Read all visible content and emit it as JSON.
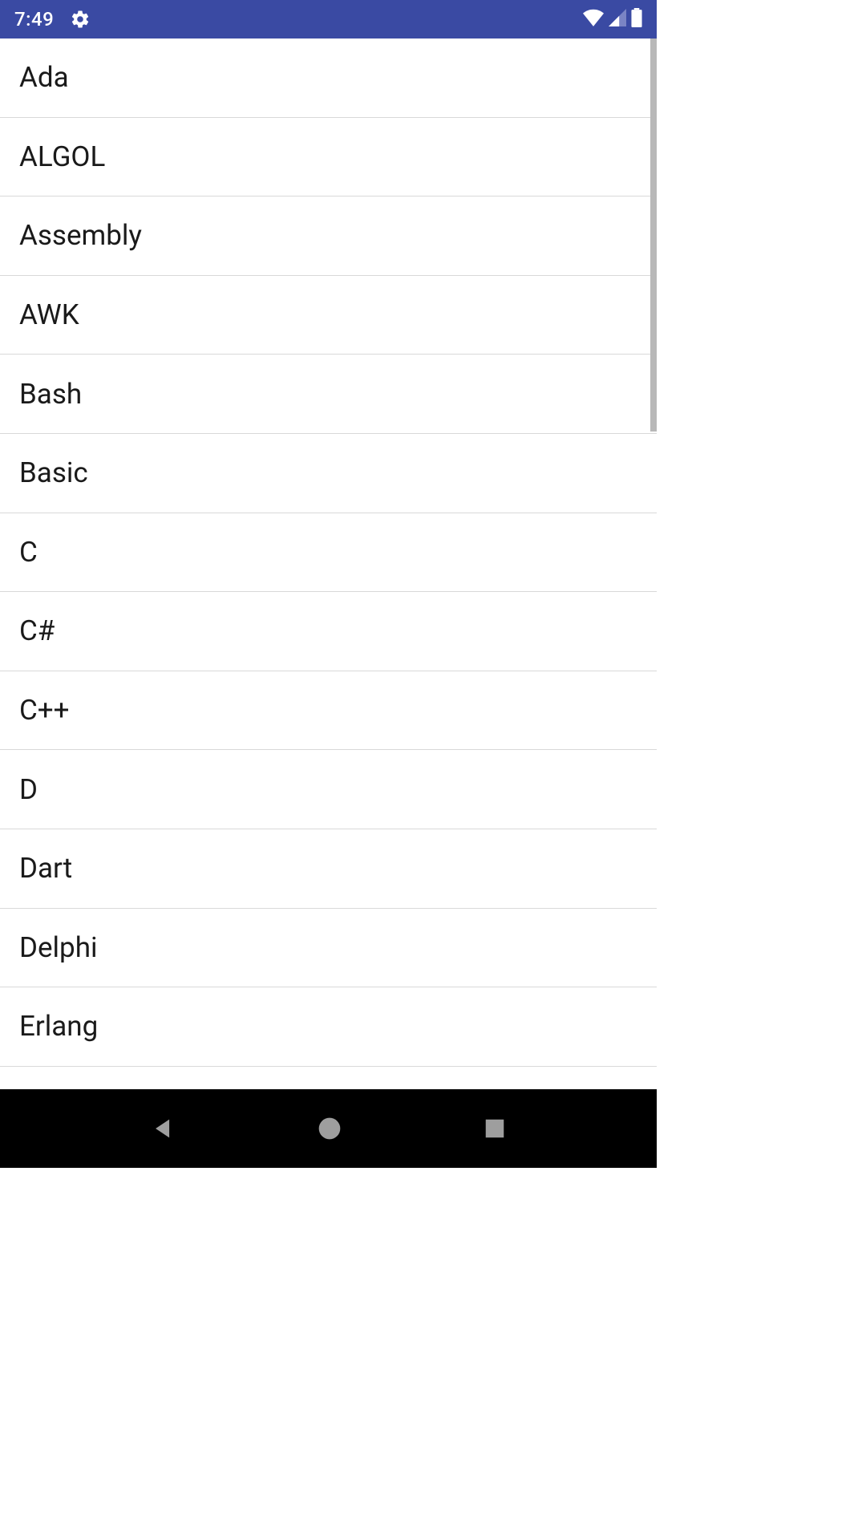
{
  "status_bar": {
    "time": "7:49",
    "icons": {
      "settings": "gear-icon",
      "wifi": "wifi-icon",
      "signal": "signal-icon",
      "battery": "battery-icon"
    }
  },
  "list": {
    "items": [
      {
        "label": "Ada"
      },
      {
        "label": "ALGOL"
      },
      {
        "label": "Assembly"
      },
      {
        "label": "AWK"
      },
      {
        "label": "Bash"
      },
      {
        "label": "Basic"
      },
      {
        "label": "C"
      },
      {
        "label": "C#"
      },
      {
        "label": "C++"
      },
      {
        "label": "D"
      },
      {
        "label": "Dart"
      },
      {
        "label": "Delphi"
      },
      {
        "label": "Erlang"
      }
    ]
  },
  "nav_bar": {
    "back": "back-icon",
    "home": "home-icon",
    "recent": "recent-icon"
  }
}
